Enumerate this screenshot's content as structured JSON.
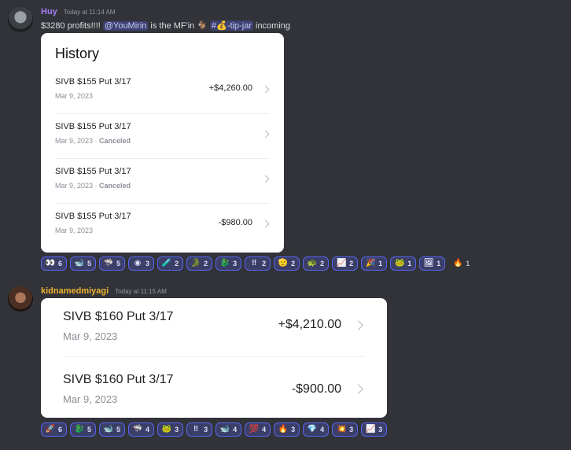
{
  "message1": {
    "username": "Huy",
    "username_color": "#a37ff7",
    "timestamp": "Today at 11:14 AM",
    "text_before": "$3280 profits!!!!",
    "mention": "@YouMirin",
    "text_middle": "is the MF'in",
    "goat_emoji": "🐐",
    "channel_prefix": "#",
    "channel_emoji": "💰",
    "channel_name": "-tip-jar",
    "text_after": "incoming",
    "history": {
      "title": "History",
      "rows": [
        {
          "title": "SIVB $155 Put 3/17",
          "date": "Mar 9, 2023",
          "status": "",
          "amount": "+$4,260.00"
        },
        {
          "title": "SIVB $155 Put 3/17",
          "date": "Mar 9, 2023",
          "status": "Canceled",
          "amount": ""
        },
        {
          "title": "SIVB $155 Put 3/17",
          "date": "Mar 9, 2023",
          "status": "Canceled",
          "amount": ""
        },
        {
          "title": "SIVB $155 Put 3/17",
          "date": "Mar 9, 2023",
          "status": "",
          "amount": "-$980.00"
        }
      ]
    },
    "reactions": [
      {
        "icon": "👀",
        "icon_name": "eyes-icon",
        "count": "6"
      },
      {
        "icon": "🐋",
        "icon_name": "whale-icon",
        "count": "5"
      },
      {
        "icon": "🦈",
        "icon_name": "fish-icon",
        "count": "5"
      },
      {
        "icon": "◉",
        "icon_name": "dark-circle-icon",
        "count": "3"
      },
      {
        "icon": "🧪",
        "icon_name": "test-tube-icon",
        "count": "2"
      },
      {
        "icon": "🐊",
        "icon_name": "crocodile-icon",
        "count": "2"
      },
      {
        "icon": "🐉",
        "icon_name": "dragon-icon",
        "count": "3"
      },
      {
        "icon": "‼",
        "icon_name": "double-exclamation-icon",
        "count": "2"
      },
      {
        "icon": "🫡",
        "icon_name": "salute-icon",
        "count": "2"
      },
      {
        "icon": "🐢",
        "icon_name": "turtle-icon",
        "count": "2"
      },
      {
        "icon": "📈",
        "icon_name": "chart-up-icon",
        "count": "2"
      },
      {
        "icon": "🎉",
        "icon_name": "party-icon",
        "count": "1"
      },
      {
        "icon": "🐸",
        "icon_name": "frog-icon",
        "count": "1"
      },
      {
        "icon": "🖼",
        "icon_name": "picture-icon",
        "count": "1"
      },
      {
        "icon": "🔥",
        "icon_name": "fire-icon",
        "count": "1"
      }
    ]
  },
  "message2": {
    "username": "kidnamedmiyagi",
    "username_color": "#f0b232",
    "timestamp": "Today at 11:15 AM",
    "rows": [
      {
        "title": "SIVB $160 Put 3/17",
        "date": "Mar 9, 2023",
        "amount": "+$4,210.00"
      },
      {
        "title": "SIVB $160 Put 3/17",
        "date": "Mar 9, 2023",
        "amount": "-$900.00"
      }
    ],
    "reactions": [
      {
        "icon": "🚀",
        "icon_name": "rocket-icon",
        "count": "6"
      },
      {
        "icon": "🐉",
        "icon_name": "dragon-icon",
        "count": "5"
      },
      {
        "icon": "🐋",
        "icon_name": "whale-icon",
        "count": "5"
      },
      {
        "icon": "🦈",
        "icon_name": "fish-icon",
        "count": "4"
      },
      {
        "icon": "🐸",
        "icon_name": "frog-icon",
        "count": "3"
      },
      {
        "icon": "‼",
        "icon_name": "double-exclamation-icon",
        "count": "3"
      },
      {
        "icon": "🐋",
        "icon_name": "dolphin-icon",
        "count": "4"
      },
      {
        "icon": "💯",
        "icon_name": "hundred-icon",
        "count": "4"
      },
      {
        "icon": "🔥",
        "icon_name": "fire-icon",
        "count": "3"
      },
      {
        "icon": "💎",
        "icon_name": "gem-icon",
        "count": "4"
      },
      {
        "icon": "💥",
        "icon_name": "boom-icon",
        "count": "3"
      },
      {
        "icon": "📈",
        "icon_name": "chart-up-icon",
        "count": "3"
      }
    ]
  }
}
